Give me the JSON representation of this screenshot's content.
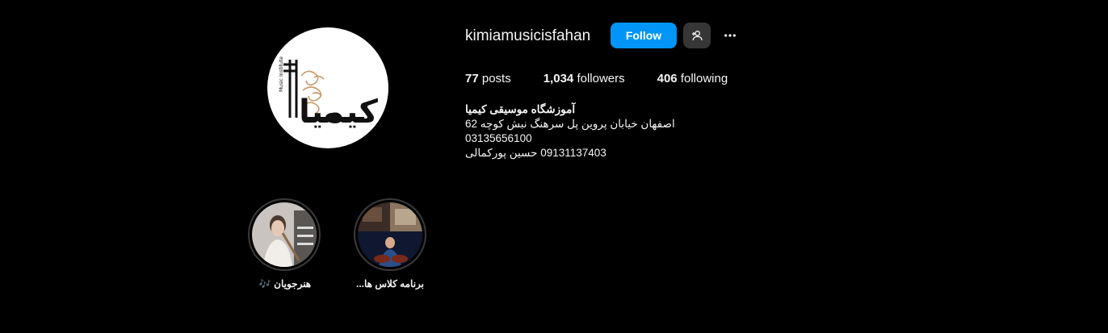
{
  "profile": {
    "username": "kimiamusicisfahan",
    "follow_label": "Follow",
    "suggest_icon": "person-add-icon",
    "more_icon": "more-horizontal-icon",
    "avatar_text": "کیمیا"
  },
  "stats": {
    "posts_count": "77",
    "posts_label": "posts",
    "followers_count": "1,034",
    "followers_label": "followers",
    "following_count": "406",
    "following_label": "following"
  },
  "bio": {
    "name": "آموزشگاه موسیقی کیمیا",
    "address": "اصفهان خیابان پروین پل سرهنگ نبش کوچه 62",
    "phone": "03135656100",
    "contact": "09131137403 حسین پورکمالی"
  },
  "highlights": [
    {
      "label": "هنرجویان",
      "emoji": "🎶"
    },
    {
      "label": "برنامه کلاس ها...",
      "emoji": ""
    }
  ],
  "colors": {
    "accent": "#0095f6",
    "background": "#000000",
    "secondary_button": "#363636"
  }
}
